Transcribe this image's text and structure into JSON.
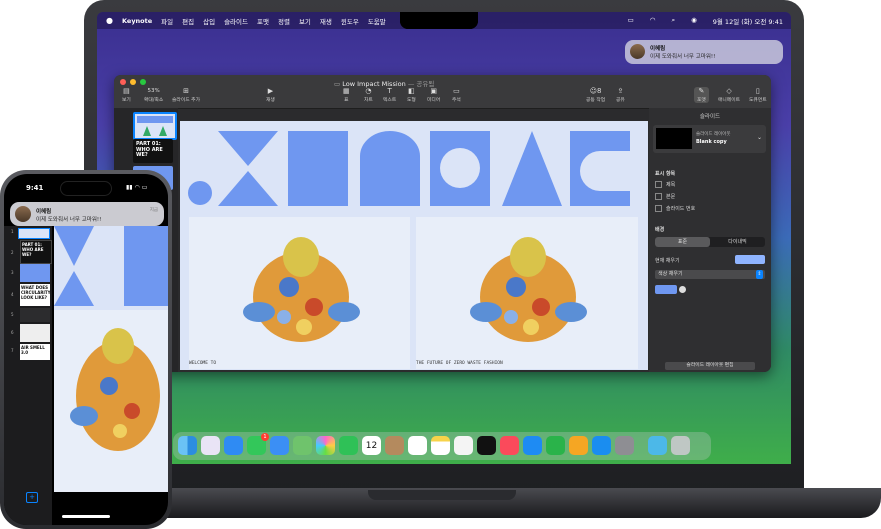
{
  "macbook": {
    "menubar": {
      "app_name": "Keynote",
      "items": [
        "파일",
        "편집",
        "삽입",
        "슬라이드",
        "포맷",
        "정렬",
        "보기",
        "재생",
        "윈도우",
        "도움말"
      ],
      "datetime": "9월 12일 (화) 오전 9:41"
    },
    "notification": {
      "sender": "이혜림",
      "message": "이제 도와줘서 너무 고마워!!"
    },
    "keynote_window": {
      "title": "Low Impact Mission",
      "title_suffix": "— 공유됨",
      "toolbar": {
        "view": "보기",
        "zoom_value": "53%",
        "zoom_label": "확대/축소",
        "add_slide": "슬라이드 추가",
        "play": "재생",
        "table": "표",
        "chart": "차트",
        "text": "텍스트",
        "shape": "도형",
        "media": "미디어",
        "comment": "주석",
        "collaborate_count": "8",
        "collaborate": "공동 작업",
        "share": "공유",
        "format": "포맷",
        "animate": "애니메이트",
        "document": "도큐먼트"
      },
      "slide": {
        "left_caption": "WELCOME TO",
        "right_caption": "THE FUTURE OF ZERO WASTE FASHION"
      },
      "thumbnails": [
        "IMPACT",
        "PART 01: WHO ARE WE?",
        ""
      ],
      "inspector": {
        "tab": "슬라이드",
        "layout_label": "슬라이드 레이아웃",
        "layout_value": "Blank copy",
        "appearance_heading": "표시 항목",
        "checkboxes": [
          "제목",
          "본문",
          "슬라이드 번호"
        ],
        "background_heading": "배경",
        "seg_standard": "표준",
        "seg_dynamic": "다이내믹",
        "fill_label": "현재 채우기",
        "fill_select": "색상 채우기",
        "edit_button": "슬라이드 레이아웃 편집"
      }
    },
    "dock": {
      "apps": [
        "Finder",
        "Launchpad",
        "Safari",
        "Messages",
        "Mail",
        "Maps",
        "Photos",
        "FaceTime",
        "Calendar",
        "Contacts",
        "Reminders",
        "Notes",
        "Freeform",
        "TV",
        "Music",
        "Keynote",
        "Numbers",
        "Pages",
        "App Store",
        "System Settings",
        "Downloads",
        "Trash"
      ],
      "calendar_day": "12",
      "messages_badge": "1"
    }
  },
  "iphone": {
    "time": "9:41",
    "notification": {
      "sender": "이혜림",
      "message": "이제 도와줘서 너무 고마워!!",
      "when": "지금"
    },
    "thumb_numbers": [
      "1",
      "2",
      "3",
      "4",
      "5",
      "6",
      "7"
    ],
    "thumb_labels": [
      "PART 01: WHO ARE WE?",
      "WHAT DOES CIRCULARITY LOOK LIKE?",
      "AIR SMELL 3.0"
    ]
  },
  "colors": {
    "slide_bg": "#dbe4f7",
    "shape_blue": "#6f97f0",
    "accent": "#0a84ff"
  }
}
